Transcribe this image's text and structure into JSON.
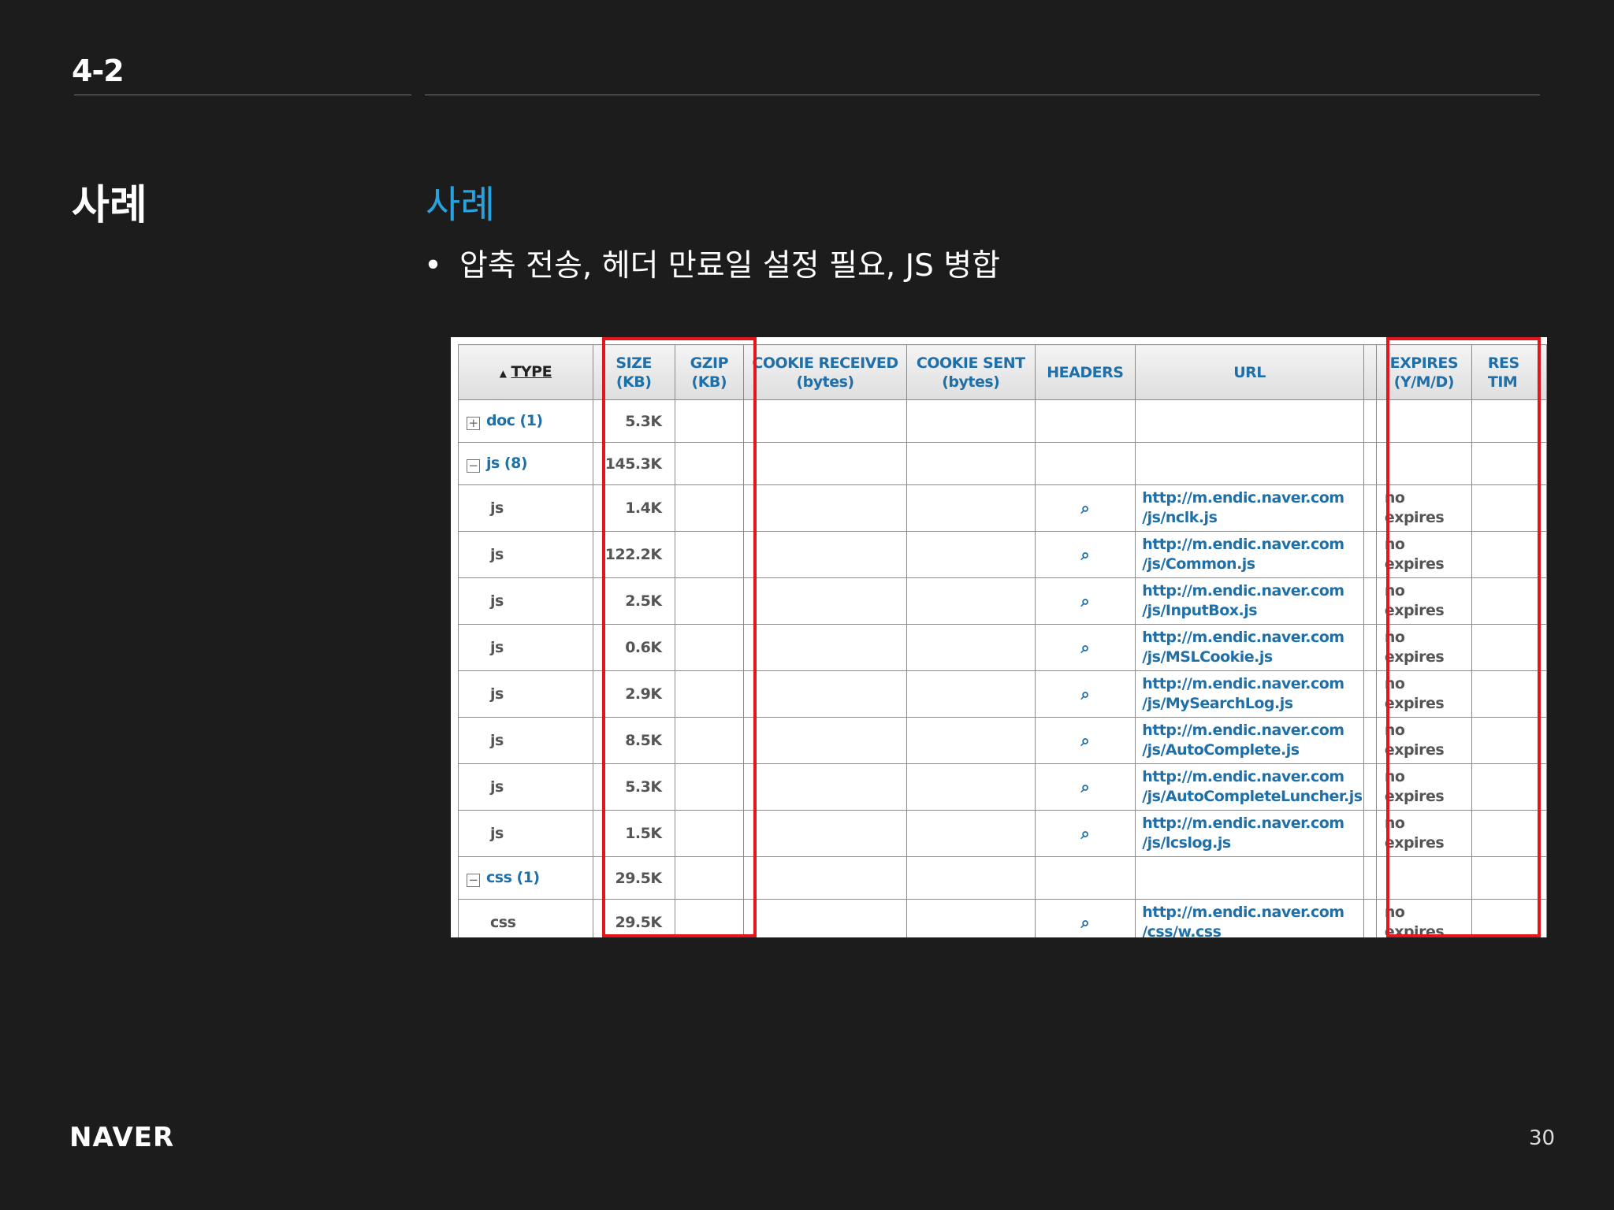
{
  "slide": {
    "section": "4-2",
    "title": "사례",
    "subtitle": "사례",
    "bullet": "압축 전송, 헤더 만료일 설정 필요, JS 병합",
    "logo": "NAVER",
    "page": "30"
  },
  "table": {
    "headers": {
      "type": "TYPE",
      "sort_icon": "▲",
      "size": "SIZE",
      "size_unit": "(KB)",
      "gzip": "GZIP",
      "gzip_unit": "(KB)",
      "cookie_received": "COOKIE RECEIVED",
      "cookie_received_unit": "(bytes)",
      "cookie_sent": "COOKIE SENT",
      "cookie_sent_unit": "(bytes)",
      "headers": "HEADERS",
      "url": "URL",
      "expires": "EXPIRES",
      "expires_unit": "(Y/M/D)",
      "response": "RES",
      "response_unit": "TIM"
    },
    "groups": {
      "doc": {
        "label": "doc (1)",
        "size": "5.3K",
        "toggle": "+"
      },
      "js": {
        "label": "js (8)",
        "size": "145.3K",
        "toggle": "−"
      },
      "css": {
        "label": "css (1)",
        "size": "29.5K",
        "toggle": "−"
      }
    },
    "rows": [
      {
        "type": "js",
        "size": "1.4K",
        "url1": "http://m.endic.naver.com",
        "url2": "/js/nclk.js",
        "exp1": "no",
        "exp2": "expires"
      },
      {
        "type": "js",
        "size": "122.2K",
        "url1": "http://m.endic.naver.com",
        "url2": "/js/Common.js",
        "exp1": "no",
        "exp2": "expires"
      },
      {
        "type": "js",
        "size": "2.5K",
        "url1": "http://m.endic.naver.com",
        "url2": "/js/InputBox.js",
        "exp1": "no",
        "exp2": "expires"
      },
      {
        "type": "js",
        "size": "0.6K",
        "url1": "http://m.endic.naver.com",
        "url2": "/js/MSLCookie.js",
        "exp1": "no",
        "exp2": "expires"
      },
      {
        "type": "js",
        "size": "2.9K",
        "url1": "http://m.endic.naver.com",
        "url2": "/js/MySearchLog.js",
        "exp1": "no",
        "exp2": "expires"
      },
      {
        "type": "js",
        "size": "8.5K",
        "url1": "http://m.endic.naver.com",
        "url2": "/js/AutoComplete.js",
        "exp1": "no",
        "exp2": "expires"
      },
      {
        "type": "js",
        "size": "5.3K",
        "url1": "http://m.endic.naver.com",
        "url2": "/js/AutoCompleteLuncher.js",
        "exp1": "no",
        "exp2": "expires"
      },
      {
        "type": "js",
        "size": "1.5K",
        "url1": "http://m.endic.naver.com",
        "url2": "/js/lcslog.js",
        "exp1": "no",
        "exp2": "expires"
      },
      {
        "type": "css",
        "size": "29.5K",
        "url1": "http://m.endic.naver.com",
        "url2": "/css/w.css",
        "exp1": "no",
        "exp2": "expires"
      }
    ],
    "highlight_color": "#e4161b"
  }
}
